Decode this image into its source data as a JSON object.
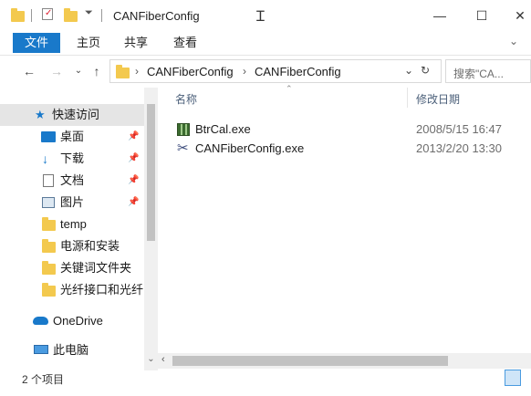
{
  "window": {
    "title": "CANFiberConfig"
  },
  "ribbon": {
    "tabs": [
      "文件",
      "主页",
      "共享",
      "查看"
    ]
  },
  "address": {
    "path": [
      "CANFiberConfig",
      "CANFiberConfig"
    ],
    "search_placeholder": "搜索\"CA..."
  },
  "sidebar": {
    "items": [
      {
        "label": "快速访问",
        "icon": "star-icon"
      },
      {
        "label": "桌面",
        "icon": "desktop-icon",
        "pinned": true
      },
      {
        "label": "下载",
        "icon": "download-icon",
        "pinned": true
      },
      {
        "label": "文档",
        "icon": "document-icon",
        "pinned": true
      },
      {
        "label": "图片",
        "icon": "picture-icon",
        "pinned": true
      },
      {
        "label": "temp",
        "icon": "folder-icon"
      },
      {
        "label": "电源和安装",
        "icon": "folder-icon"
      },
      {
        "label": "关键词文件夹",
        "icon": "folder-icon"
      },
      {
        "label": "光纤接口和光纤",
        "icon": "folder-icon"
      },
      {
        "label": "OneDrive",
        "icon": "cloud-icon"
      },
      {
        "label": "此电脑",
        "icon": "computer-icon"
      }
    ]
  },
  "list": {
    "headers": {
      "name": "名称",
      "modified": "修改日期"
    },
    "files": [
      {
        "name": "BtrCal.exe",
        "modified": "2008/5/15 16:47",
        "icon": "exe-grid-icon"
      },
      {
        "name": "CANFiberConfig.exe",
        "modified": "2013/2/20 13:30",
        "icon": "exe-tools-icon"
      }
    ]
  },
  "status": {
    "count": "2 个项目"
  },
  "colors": {
    "accent": "#1979ca",
    "folder": "#f3c94e",
    "selection": "#e5e5e5"
  }
}
